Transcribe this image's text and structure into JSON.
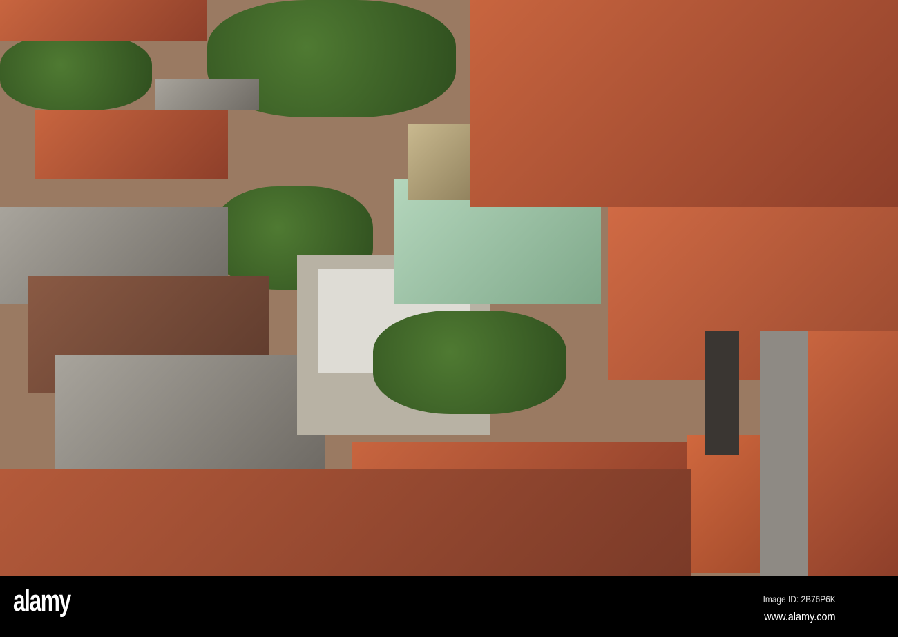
{
  "photo": {
    "subject": "aerial-city-center"
  },
  "watermark": {
    "logo": "alamy",
    "image_id": "Image ID: 2B76P6K",
    "website": "www.alamy.com"
  },
  "colors": {
    "bar": "#000000",
    "roof": "#b8583a",
    "trees": "#3f6a2a",
    "cathedral_roof": "#9fc4a8"
  }
}
